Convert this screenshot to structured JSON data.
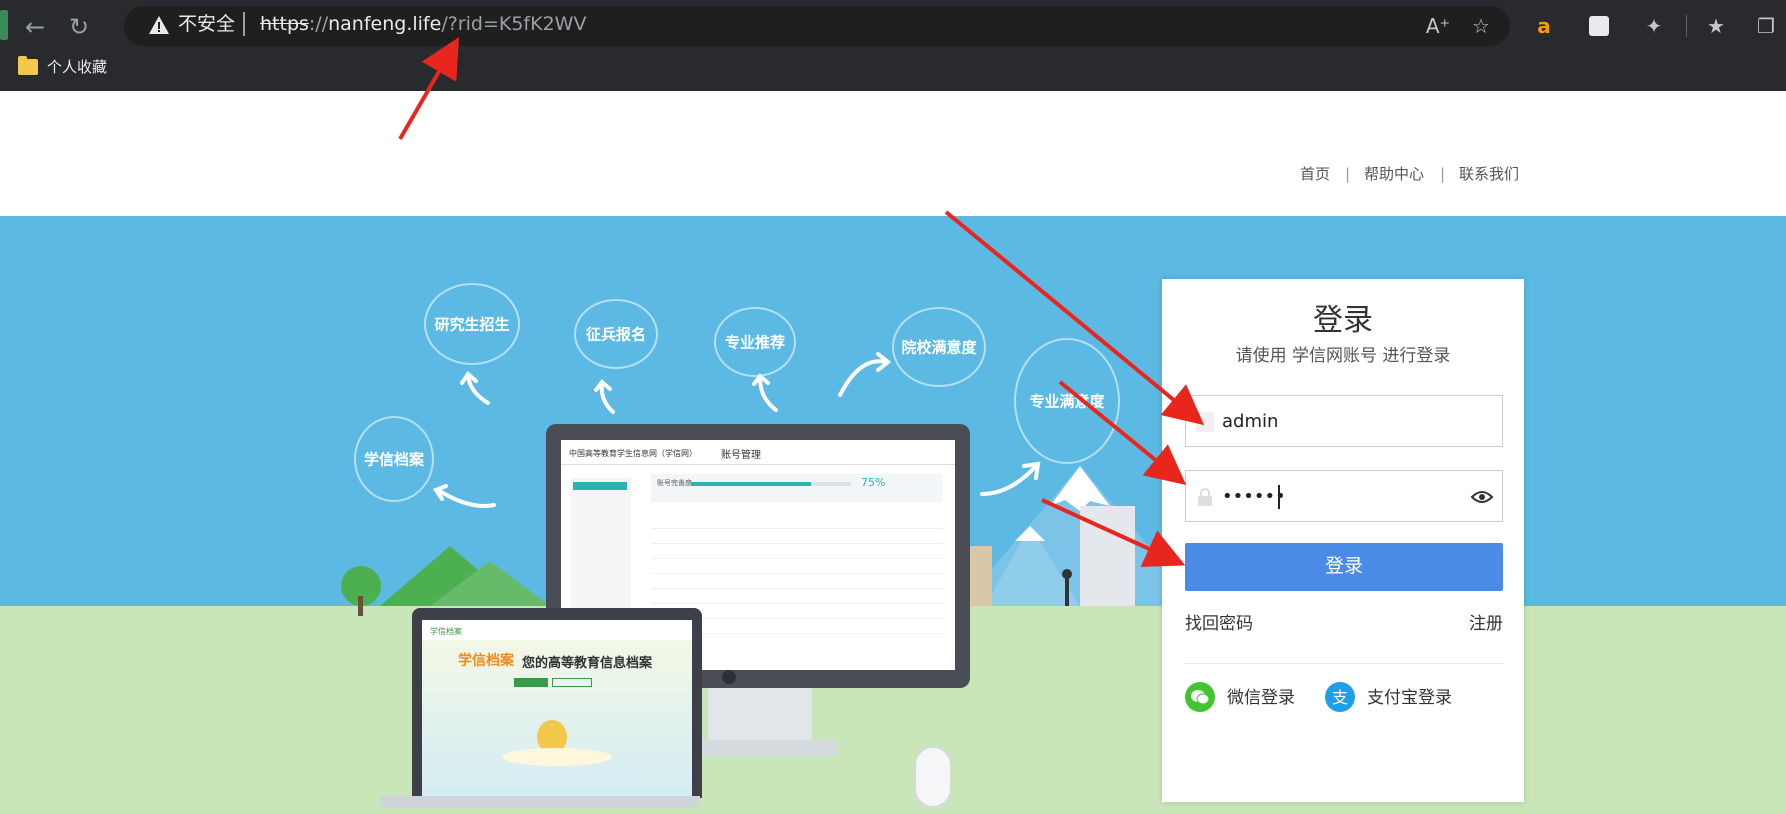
{
  "browser": {
    "security_label": "不安全",
    "url_scheme": "https",
    "url_sep": "://",
    "url_host": "nanfeng.life",
    "url_path": "/?rid=K5fK2WV",
    "bookmark_folder": "个人收藏",
    "icons": [
      "back-icon",
      "reload-icon",
      "warning-icon",
      "read-aloud-icon",
      "add-favorite-icon",
      "extension-amazon-icon",
      "extension-bird-icon",
      "extensions-icon",
      "favorites-icon",
      "collections-icon"
    ]
  },
  "site_nav": {
    "items": [
      "首页",
      "帮助中心",
      "联系我们"
    ],
    "separator": "|"
  },
  "illustration": {
    "bubbles": [
      "研究生招生",
      "征兵报名",
      "专业推荐",
      "院校满意度",
      "学信档案",
      "专业满意度"
    ],
    "monitor_screen": {
      "site_name": "中国高等教育学生信息网（学信网）",
      "section": "账号管理",
      "progress_label": "账号完善度",
      "progress_value": "75%"
    },
    "laptop_screen": {
      "brand": "学信档案",
      "headline": "您的高等教育信息档案"
    }
  },
  "login": {
    "title": "登录",
    "subtitle": "请使用 学信网账号 进行登录",
    "username_value": "admin",
    "password_mask": "••••••",
    "submit_label": "登录",
    "forgot_label": "找回密码",
    "register_label": "注册",
    "wechat_label": "微信登录",
    "alipay_label": "支付宝登录"
  },
  "colors": {
    "sky": "#5cb9e4",
    "grass": "#c8e6b8",
    "primary_button": "#4a8be8",
    "annotation_arrow": "#e8261d",
    "wechat": "#41c531",
    "alipay": "#1ea0e8"
  }
}
